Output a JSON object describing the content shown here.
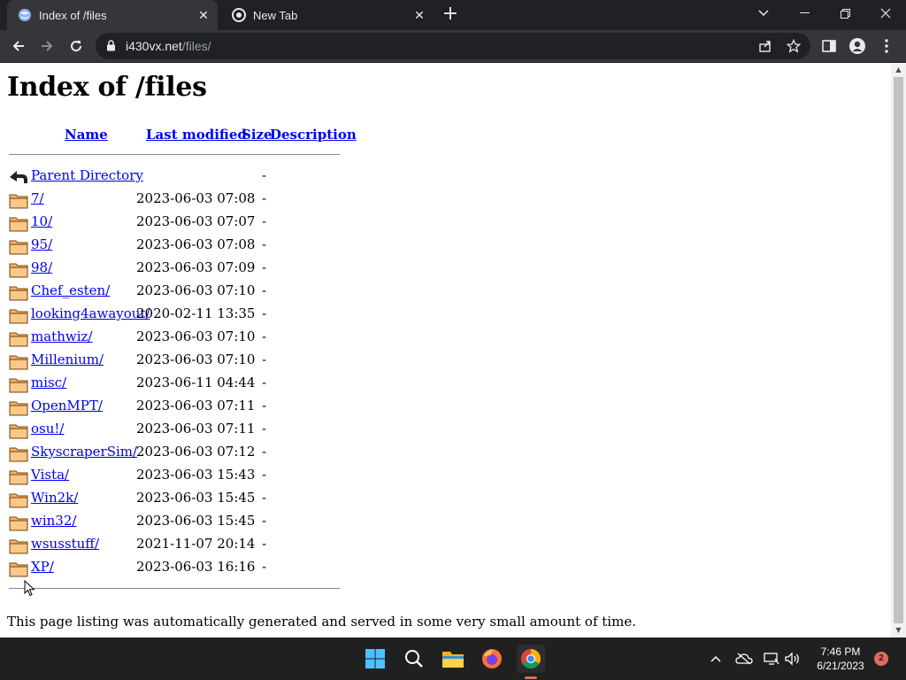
{
  "browser": {
    "tabs": [
      {
        "title": "Index of /files",
        "active": true
      },
      {
        "title": "New Tab",
        "active": false
      }
    ],
    "url": {
      "host": "i430vx.net",
      "path": "/files/"
    }
  },
  "page": {
    "heading": "Index of /files",
    "columns": {
      "name": "Name",
      "last_modified": "Last modified",
      "size": "Size",
      "description": "Description"
    },
    "parent": {
      "name": "Parent Directory",
      "size": "-"
    },
    "entries": [
      {
        "name": "7/",
        "modified": "2023-06-03 07:08",
        "size": "-"
      },
      {
        "name": "10/",
        "modified": "2023-06-03 07:07",
        "size": "-"
      },
      {
        "name": "95/",
        "modified": "2023-06-03 07:08",
        "size": "-"
      },
      {
        "name": "98/",
        "modified": "2023-06-03 07:09",
        "size": "-"
      },
      {
        "name": "Chef_esten/",
        "modified": "2023-06-03 07:10",
        "size": "-"
      },
      {
        "name": "looking4awayout/",
        "modified": "2020-02-11 13:35",
        "size": "-"
      },
      {
        "name": "mathwiz/",
        "modified": "2023-06-03 07:10",
        "size": "-"
      },
      {
        "name": "Millenium/",
        "modified": "2023-06-03 07:10",
        "size": "-"
      },
      {
        "name": "misc/",
        "modified": "2023-06-11 04:44",
        "size": "-"
      },
      {
        "name": "OpenMPT/",
        "modified": "2023-06-03 07:11",
        "size": "-"
      },
      {
        "name": "osu!/",
        "modified": "2023-06-03 07:11",
        "size": "-"
      },
      {
        "name": "SkyscraperSim/",
        "modified": "2023-06-03 07:12",
        "size": "-"
      },
      {
        "name": "Vista/",
        "modified": "2023-06-03 15:43",
        "size": "-"
      },
      {
        "name": "Win2k/",
        "modified": "2023-06-03 15:45",
        "size": "-"
      },
      {
        "name": "win32/",
        "modified": "2023-06-03 15:45",
        "size": "-"
      },
      {
        "name": "wsusstuff/",
        "modified": "2021-11-07 20:14",
        "size": "-"
      },
      {
        "name": "XP/",
        "modified": "2023-06-03 16:16",
        "size": "-"
      }
    ],
    "footer": "This page listing was automatically generated and served in some very small amount of time."
  },
  "taskbar": {
    "apps": [
      "start-icon",
      "search-icon",
      "file-explorer-icon",
      "firefox-icon",
      "chrome-icon"
    ],
    "active_app": "chrome-icon",
    "time": "7:46 PM",
    "date": "6/21/2023",
    "notification_count": "2"
  },
  "colors": {
    "link": "#0000ee",
    "chrome_dark": "#202124",
    "toolbar": "#35363a",
    "taskbar": "#202020"
  }
}
